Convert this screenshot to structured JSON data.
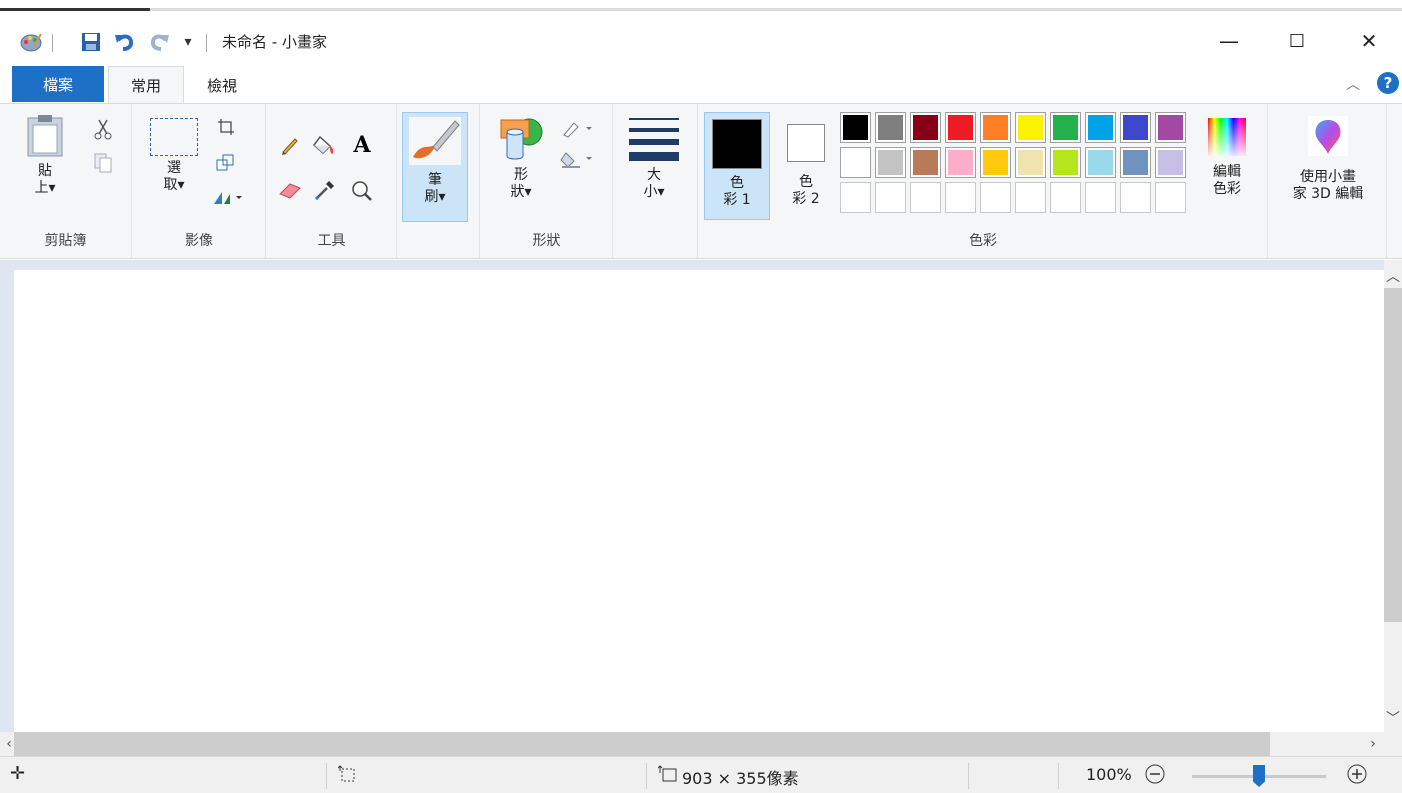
{
  "window": {
    "title": "未命名 - 小畫家",
    "minimize_glyph": "—",
    "maximize_glyph": "☐",
    "close_glyph": "✕"
  },
  "tabs": {
    "file": "檔案",
    "home": "常用",
    "view": "檢視"
  },
  "ribbon": {
    "clipboard": {
      "paste_label": "貼\n上▾",
      "group_label": "剪貼簿"
    },
    "image": {
      "select_label": "選\n取▾",
      "group_label": "影像"
    },
    "tools": {
      "group_label": "工具",
      "text_glyph": "A"
    },
    "brushes": {
      "label": "筆\n刷▾"
    },
    "shapes": {
      "label": "形\n狀▾",
      "group_label": "形狀"
    },
    "size": {
      "label": "大\n小▾"
    },
    "colors": {
      "color1_label": "色\n彩 1",
      "color2_label": "色\n彩 2",
      "edit_label": "編輯\n色彩",
      "group_label": "色彩",
      "color1": "#000000",
      "color2": "#ffffff",
      "palette_row1": [
        "#000000",
        "#7f7f7f",
        "#880015",
        "#ed1c24",
        "#ff7f27",
        "#fff200",
        "#22b14c",
        "#00a2e8",
        "#3f48cc",
        "#a349a4"
      ],
      "palette_row2": [
        "#ffffff",
        "#c3c3c3",
        "#b97a57",
        "#ffaec9",
        "#ffc90e",
        "#efe4b0",
        "#b5e61d",
        "#99d9ea",
        "#7092be",
        "#c8bfe7"
      ]
    },
    "paint3d": {
      "label": "使用小畫\n家 3D 編輯"
    }
  },
  "status": {
    "canvas_size": "903 × 355像素",
    "zoom": "100%",
    "zoom_level": 1.0
  }
}
